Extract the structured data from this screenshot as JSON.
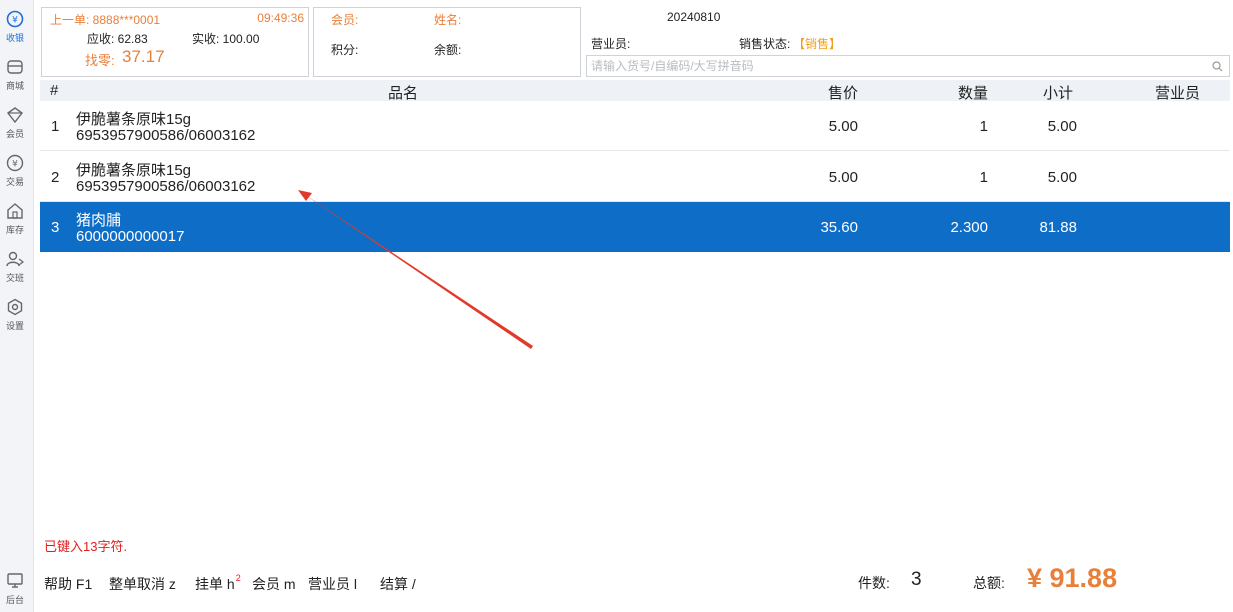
{
  "sidebar": {
    "items": [
      {
        "label": "收银",
        "icon": "cashier-icon",
        "active": true
      },
      {
        "label": "商城",
        "icon": "shop-icon"
      },
      {
        "label": "会员",
        "icon": "member-icon"
      },
      {
        "label": "交易",
        "icon": "yen-icon"
      },
      {
        "label": "库存",
        "icon": "warehouse-icon"
      },
      {
        "label": "交班",
        "icon": "handover-icon"
      },
      {
        "label": "设置",
        "icon": "gear-icon"
      },
      {
        "label": "后台",
        "icon": "monitor-icon"
      }
    ]
  },
  "last_order": {
    "label": "上一单: 8888***0001",
    "time": "09:49:36",
    "receivable": "应收: 62.83",
    "received": "实收: 100.00",
    "change_label": "找零:",
    "change_value": "37.17"
  },
  "member": {
    "member_label": "会员:",
    "name_label": "姓名:",
    "points_label": "积分:",
    "balance_label": "余额:"
  },
  "info": {
    "date": "20240810",
    "salesperson_label": "营业员:",
    "sale_status_label": "销售状态:",
    "sale_status_value": "【销售】"
  },
  "search": {
    "placeholder": "请输入货号/自编码/大写拼音码"
  },
  "table": {
    "headers": {
      "num": "#",
      "name": "品名",
      "price": "售价",
      "qty": "数量",
      "subtotal": "小计",
      "salesperson": "营业员"
    },
    "rows": [
      {
        "num": "1",
        "name": "伊脆薯条原味15g",
        "code": "6953957900586/06003162",
        "price": "5.00",
        "qty": "1",
        "subtotal": "5.00",
        "salesperson": ""
      },
      {
        "num": "2",
        "name": "伊脆薯条原味15g",
        "code": "6953957900586/06003162",
        "price": "5.00",
        "qty": "1",
        "subtotal": "5.00",
        "salesperson": ""
      },
      {
        "num": "3",
        "name": "猪肉脯",
        "code": "6000000000017",
        "price": "35.60",
        "qty": "2.300",
        "subtotal": "81.88",
        "salesperson": "",
        "selected": true
      }
    ]
  },
  "status_message": "已键入13字符.",
  "shortcuts": {
    "help": "帮助 F1",
    "cancel": "整单取消 z",
    "hold": "挂单 h",
    "hold_count": "2",
    "member": "会员 m",
    "salesperson": "营业员 l",
    "checkout": "结算 /"
  },
  "totals": {
    "count_label": "件数:",
    "count_value": "3",
    "amount_label": "总额:",
    "amount_value": "¥ 91.88"
  },
  "colors": {
    "accent": "#0d6dc7",
    "orange": "#e8803a",
    "error": "#e02020",
    "annotation_arrow": "#e23a2a"
  }
}
